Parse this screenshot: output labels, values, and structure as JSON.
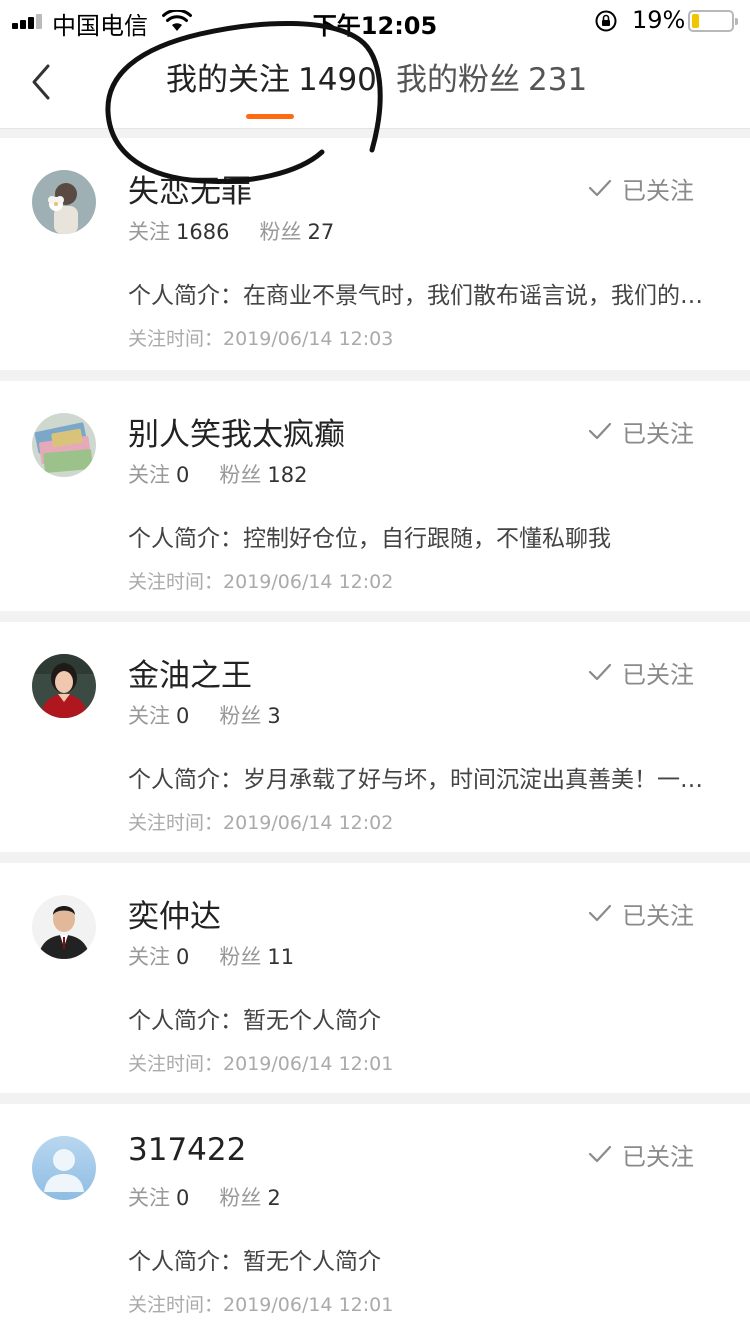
{
  "status_bar": {
    "carrier": "中国电信",
    "time": "下午12:05",
    "battery_percent": "19%",
    "battery_level": 0.19
  },
  "header": {
    "tabs": [
      {
        "label": "我的关注",
        "count": "1490",
        "active": true
      },
      {
        "label": "我的粉丝",
        "count": "231",
        "active": false
      }
    ]
  },
  "labels": {
    "following_prefix": "关注",
    "fans_prefix": "粉丝",
    "bio_prefix": "个人简介：",
    "time_prefix": "关注时间：",
    "followed_status": "已关注"
  },
  "users": [
    {
      "name": "失恋无罪",
      "following": "1686",
      "fans": "27",
      "bio": "在商业不景气时，我们散布谣言说，我们的…",
      "follow_time": "2019/06/14 12:03",
      "avatar": "flower-girl"
    },
    {
      "name": "别人笑我太疯癫",
      "following": "0",
      "fans": "182",
      "bio": "控制好仓位，自行跟随，不懂私聊我",
      "follow_time": "2019/06/14 12:02",
      "avatar": "banknotes"
    },
    {
      "name": "金油之王",
      "following": "0",
      "fans": "3",
      "bio": "岁月承载了好与坏，时间沉淀出真善美！一…",
      "follow_time": "2019/06/14 12:02",
      "avatar": "woman-red"
    },
    {
      "name": "奕仲达",
      "following": "0",
      "fans": "11",
      "bio": "暂无个人简介",
      "follow_time": "2019/06/14 12:01",
      "avatar": "man-suit"
    },
    {
      "name": "317422",
      "following": "0",
      "fans": "2",
      "bio": "暂无个人简介",
      "follow_time": "2019/06/14 12:01",
      "avatar": "default-user"
    }
  ],
  "colors": {
    "accent": "#ff6a13",
    "battery": "#f5c400",
    "divider": "#f2f2f2"
  }
}
